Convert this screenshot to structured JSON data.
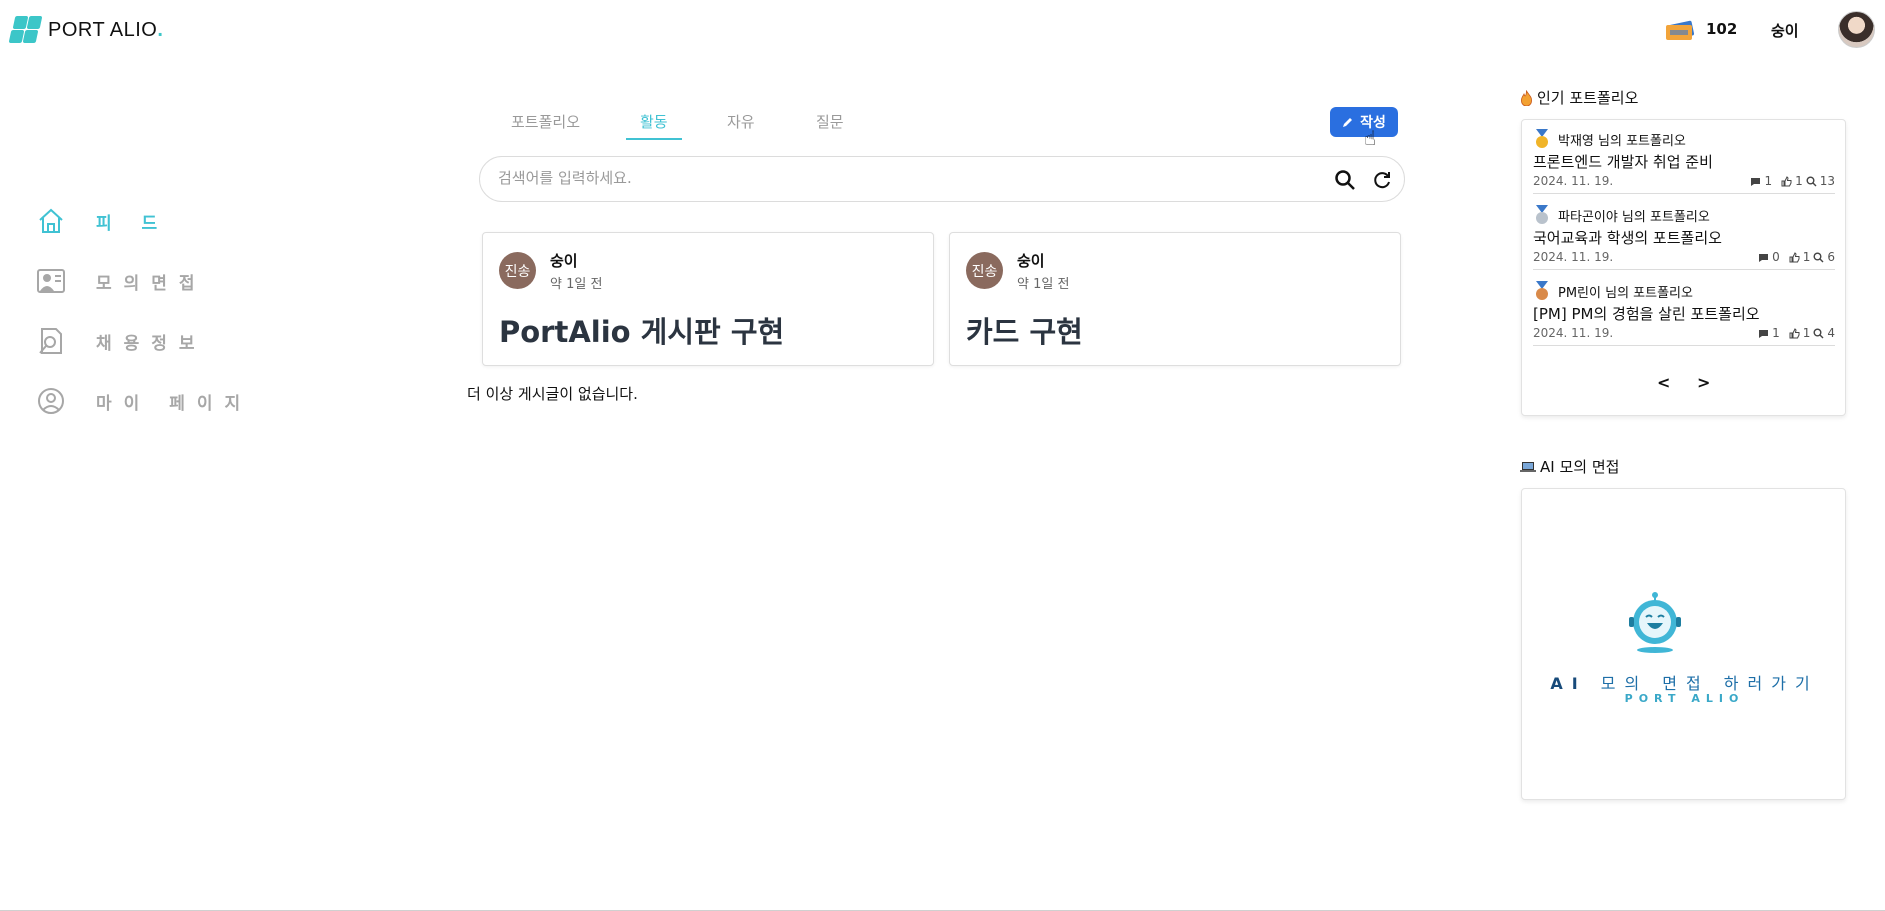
{
  "brand": {
    "name": "PORT ALIO",
    "dot": ".",
    "accent": "#3cc6c8"
  },
  "header": {
    "ticket_icon": "ticket-icon",
    "ticket_count": "102",
    "user_name": "숭이",
    "avatar_icon": "user-avatar"
  },
  "sidebar": {
    "items": [
      {
        "label": "피 드",
        "icon": "home-icon",
        "active": true
      },
      {
        "label": "모의면접",
        "icon": "interview-icon",
        "active": false
      },
      {
        "label": "채용정보",
        "icon": "job-search-icon",
        "active": false
      },
      {
        "label": "마이 페이지",
        "icon": "user-icon",
        "active": false
      }
    ]
  },
  "tabs": [
    {
      "label": "포트폴리오",
      "active": false
    },
    {
      "label": "활동",
      "active": true
    },
    {
      "label": "자유",
      "active": false
    },
    {
      "label": "질문",
      "active": false
    }
  ],
  "write_button": {
    "label": "작성",
    "icon": "pencil-icon"
  },
  "search": {
    "placeholder": "검색어를 입력하세요.",
    "value": ""
  },
  "posts": [
    {
      "avatar_text": "진송",
      "author": "숭이",
      "time": "약 1일 전",
      "title": "PortAlio 게시판 구현"
    },
    {
      "avatar_text": "진송",
      "author": "숭이",
      "time": "약 1일 전",
      "title": "카드 구현"
    }
  ],
  "no_more_text": "더 이상 게시글이 없습니다.",
  "popular": {
    "title": "인기 포트폴리오",
    "icon": "fire-icon",
    "items": [
      {
        "medal": "gold-medal-icon",
        "owner": "박재영 님의 포트폴리오",
        "title": "프론트엔드 개발자 취업 준비",
        "date": "2024. 11. 19.",
        "comments": "1",
        "likes": "1",
        "views": "13"
      },
      {
        "medal": "silver-medal-icon",
        "owner": "파타곤이야 님의 포트폴리오",
        "title": "국어교육과 학생의 포트폴리오",
        "date": "2024. 11. 19.",
        "comments": "0",
        "likes": "1",
        "views": "6"
      },
      {
        "medal": "bronze-medal-icon",
        "owner": "PM린이 님의 포트폴리오",
        "title": "[PM] PM의 경험을 살린 포트폴리오",
        "date": "2024. 11. 19.",
        "comments": "1",
        "likes": "1",
        "views": "4"
      }
    ],
    "prev": "<",
    "next": ">"
  },
  "ai_interview": {
    "title": "AI 모의 면접",
    "icon": "laptop-icon",
    "banner_prefix": "AI",
    "banner_text": "모의 면접 하러가기",
    "banner_sub": "PORT ALIO"
  }
}
